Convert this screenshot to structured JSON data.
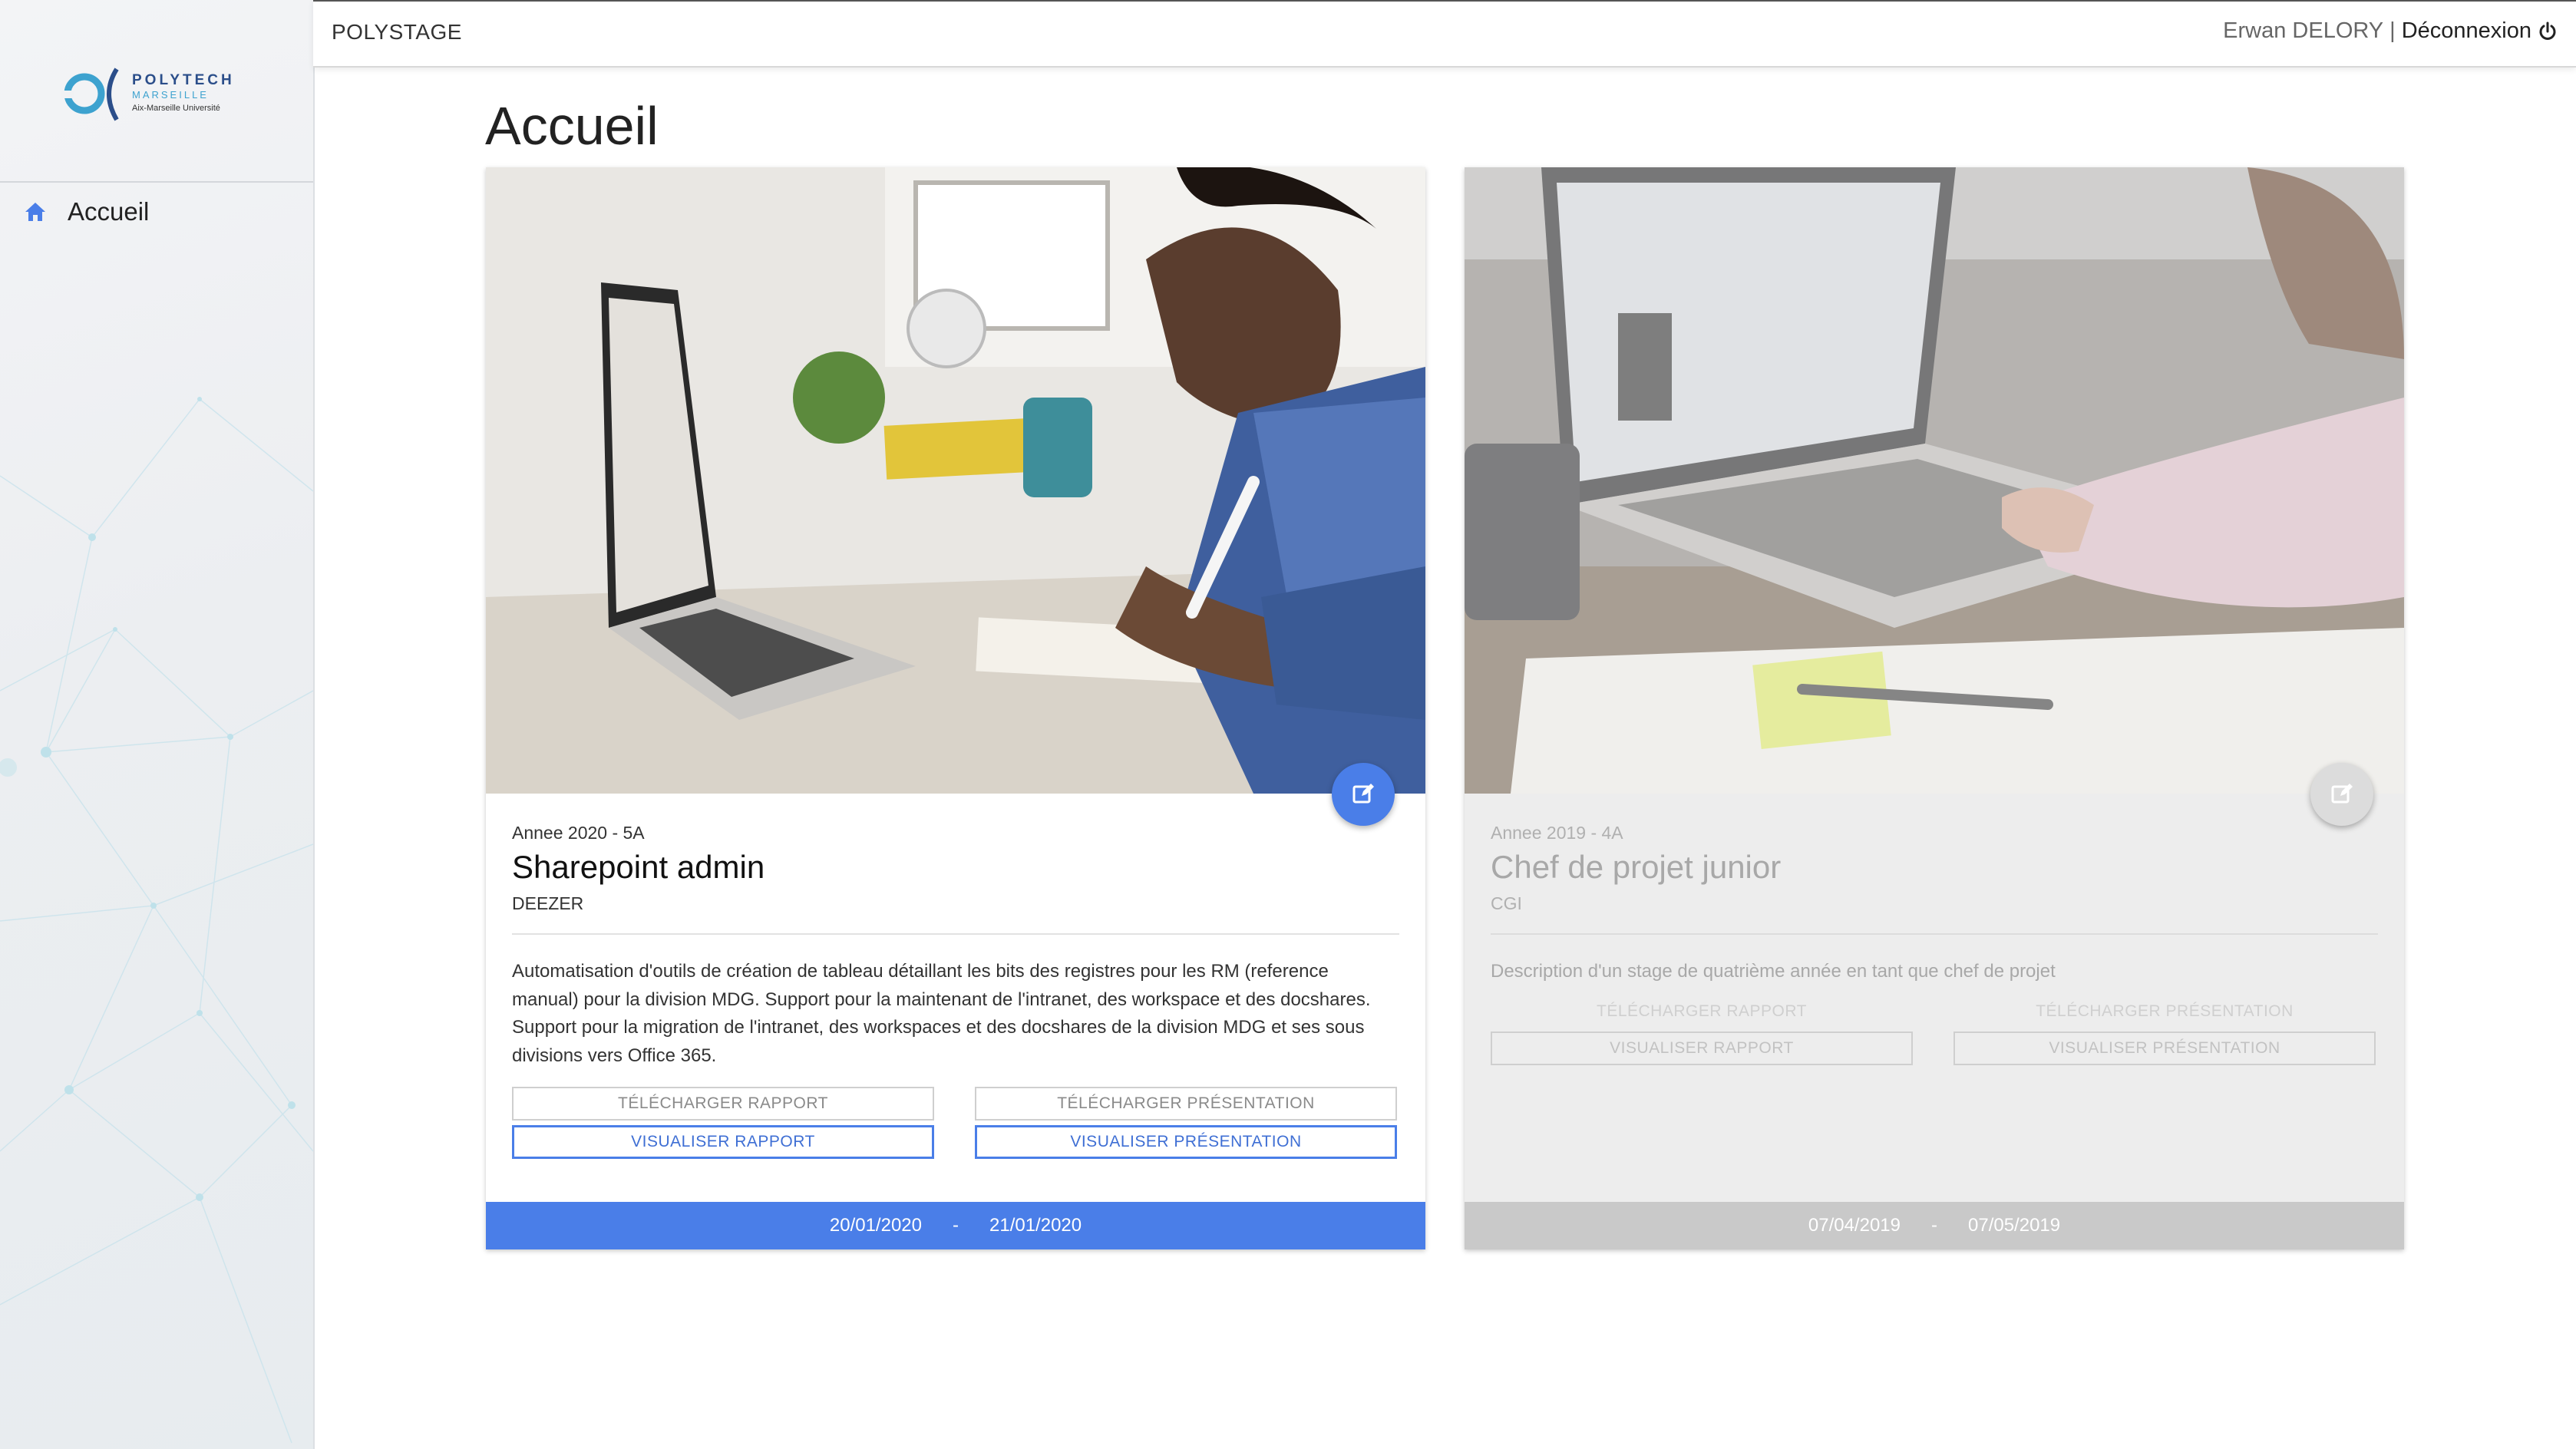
{
  "app": {
    "brand": "POLYSTAGE"
  },
  "colors": {
    "accent": "#4a7ee8",
    "inactive": "#c9c9c9"
  },
  "user": {
    "name": "Erwan DELORY",
    "separator": "|",
    "logout": "Déconnexion",
    "logout_icon": "power-icon"
  },
  "logo": {
    "line1": "POLYTECH",
    "line2": "MARSEILLE",
    "line3": "Aix-Marseille Université"
  },
  "sidebar": {
    "items": [
      {
        "label": "Accueil",
        "icon": "home-icon"
      }
    ]
  },
  "page": {
    "title": "Accueil"
  },
  "cards": [
    {
      "year": "Annee 2020 - 5A",
      "title": "Sharepoint admin",
      "company": "DEEZER",
      "description": "Automatisation d'outils de création de tableau détaillant les bits des registres pour les RM (reference manual) pour la division MDG. Support pour la maintenant de l'intranet, des workspace et des docshares. Support pour la migration de l'intranet, des workspaces et des docshares de la division MDG et ses sous divisions vers Office 365.",
      "download_report": "TÉLÉCHARGER RAPPORT",
      "view_report": "VISUALISER RAPPORT",
      "download_presentation": "TÉLÉCHARGER PRÉSENTATION",
      "view_presentation": "VISUALISER PRÉSENTATION",
      "start_date": "20/01/2020",
      "date_sep": "-",
      "end_date": "21/01/2020",
      "edit_icon": "edit-icon"
    },
    {
      "year": "Annee 2019 - 4A",
      "title": "Chef de projet junior",
      "company": "CGI",
      "description": "Description d'un stage de quatrième année en tant que chef de projet",
      "download_report": "TÉLÉCHARGER RAPPORT",
      "view_report": "VISUALISER RAPPORT",
      "download_presentation": "TÉLÉCHARGER PRÉSENTATION",
      "view_presentation": "VISUALISER PRÉSENTATION",
      "start_date": "07/04/2019",
      "date_sep": "-",
      "end_date": "07/05/2019",
      "edit_icon": "edit-icon"
    }
  ]
}
